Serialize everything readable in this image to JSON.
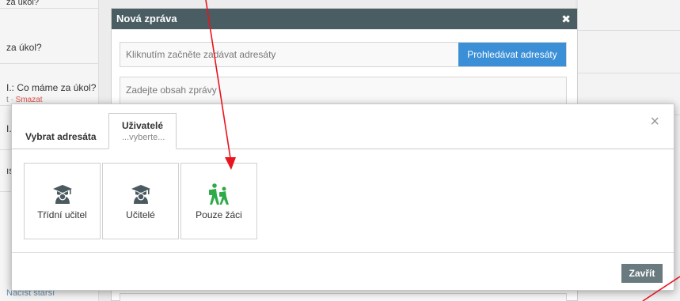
{
  "background": {
    "rows": [
      {
        "text": "za úkol?"
      },
      {
        "text": "za úkol?"
      },
      {
        "text": "I.: Co máme za úkol?"
      },
      {
        "text": "I."
      },
      {
        "text": "ıs"
      },
      {
        "text": "Načíst starší"
      }
    ],
    "row_small": {
      "prefix": "t · ",
      "delete_label": "Smazat"
    }
  },
  "compose": {
    "title": "Nová zpráva",
    "close_glyph": "✖",
    "recipients_placeholder": "Kliknutím začněte zadávat adresáty",
    "browse_button": "Prohledávat adresáty",
    "body_placeholder": "Zadejte obsah zprávy"
  },
  "chooser": {
    "close_glyph": "×",
    "title": "Vybrat adresáta",
    "tab": {
      "label": "Uživatelé",
      "sub": "...vyberte..."
    },
    "tiles": [
      {
        "label": "Třídní učitel",
        "icon": "teacher-icon",
        "color": "#4a5a60"
      },
      {
        "label": "Učitelé",
        "icon": "teacher-icon",
        "color": "#4a5a60"
      },
      {
        "label": "Pouze žáci",
        "icon": "students-walking-icon",
        "color": "#2eaa4a"
      }
    ],
    "close_button": "Zavřít"
  },
  "annotation": {
    "color": "#e8141e"
  }
}
